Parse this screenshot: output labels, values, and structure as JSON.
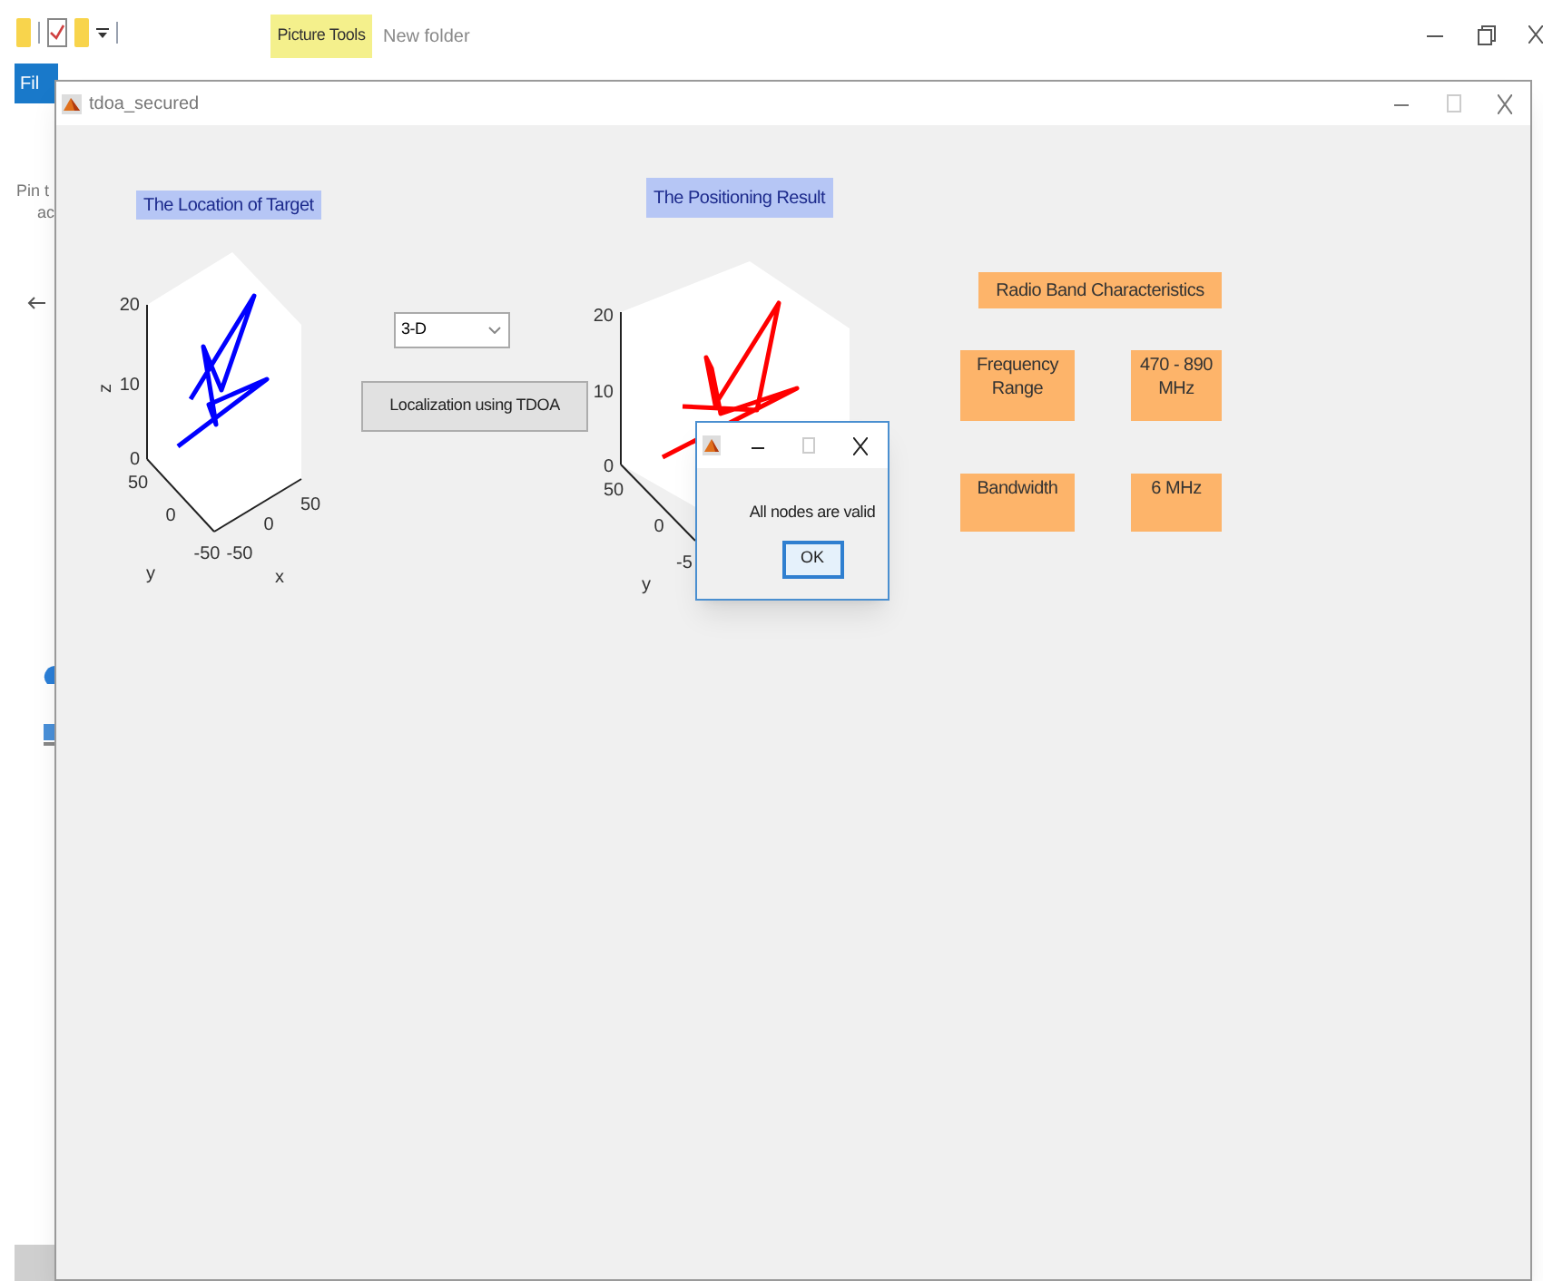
{
  "explorer": {
    "context_tab": "Picture Tools",
    "title": "New folder",
    "file_tab": "Fil",
    "pin_text": [
      "Pin t",
      "ac"
    ]
  },
  "figure": {
    "title": "tdoa_secured",
    "plots": [
      {
        "title": "The Location of Target",
        "color": "#0000ff",
        "z_ticks": [
          "20",
          "10",
          "0"
        ],
        "y_ticks": [
          "50",
          "0",
          "-50"
        ],
        "x_ticks": [
          "-50",
          "0",
          "50"
        ],
        "axis_labels": [
          "z",
          "y",
          "x"
        ]
      },
      {
        "title": "The Positioning Result",
        "color": "#ff0000",
        "z_ticks": [
          "20",
          "10",
          "0"
        ],
        "y_ticks": [
          "50",
          "0",
          "-5"
        ],
        "axis_labels": [
          "y"
        ]
      }
    ],
    "dropdown": {
      "value": "3-D"
    },
    "button": "Localization using TDOA",
    "radio_band": {
      "title": "Radio Band Characteristics",
      "rows": [
        {
          "label": "Frequency Range",
          "value": "470 - 890 MHz"
        },
        {
          "label": "Bandwidth",
          "value": "6 MHz"
        }
      ]
    }
  },
  "dialog": {
    "message": "All nodes are valid",
    "ok": "OK"
  }
}
